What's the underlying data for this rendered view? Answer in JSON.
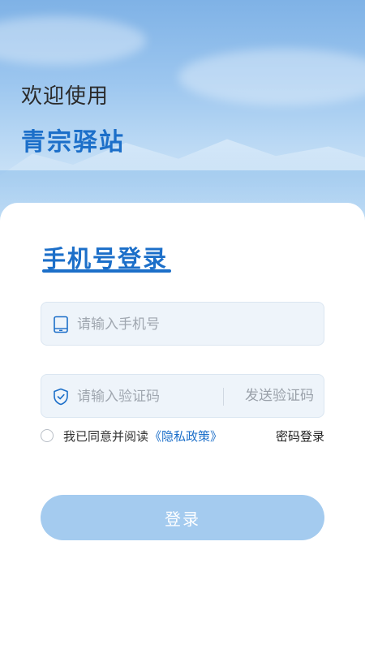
{
  "header": {
    "welcome": "欢迎使用",
    "app_name": "青宗驿站"
  },
  "login": {
    "title": "手机号登录",
    "phone_placeholder": "请输入手机号",
    "code_placeholder": "请输入验证码",
    "send_code_label": "发送验证码",
    "agree_text": "我已同意并阅读",
    "policy_link": "《隐私政策》",
    "password_login": "密码登录",
    "submit_label": "登录"
  },
  "icons": {
    "phone": "phone-icon",
    "shield": "shield-check-icon"
  },
  "colors": {
    "brand": "#1c6fc9",
    "button": "#a4cbef",
    "field_bg": "#eef4fa"
  }
}
